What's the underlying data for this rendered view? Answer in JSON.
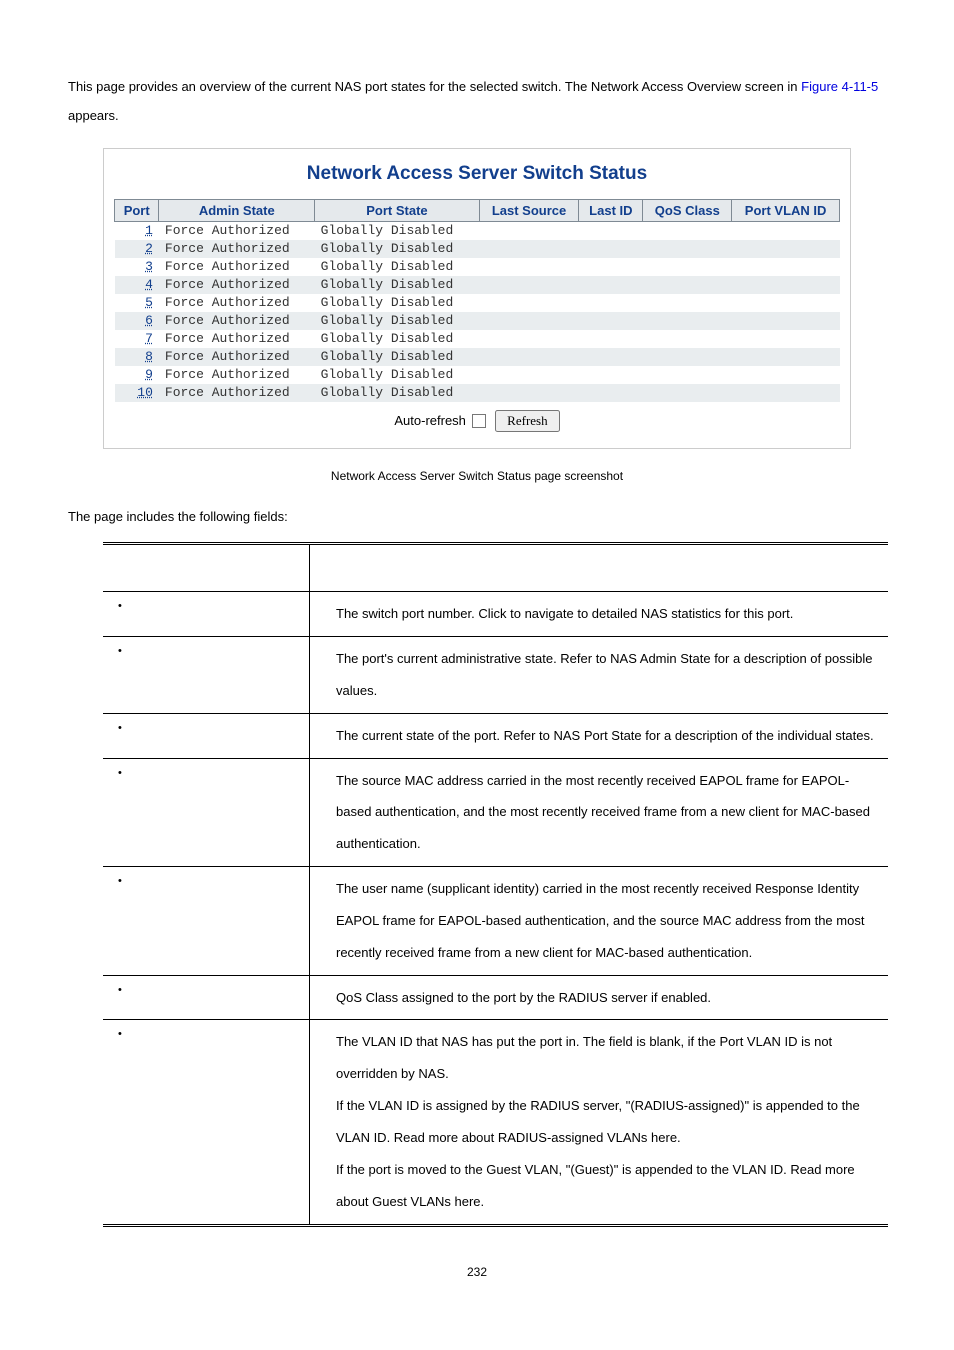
{
  "intro_text_1": "This page provides an overview of the current NAS port states for the selected switch. The Network Access Overview screen in ",
  "intro_link": "Figure 4-11-5",
  "intro_text_2": " appears.",
  "panel_title": "Network Access Server Switch Status",
  "status_headers": [
    "Port",
    "Admin State",
    "Port State",
    "Last Source",
    "Last ID",
    "QoS Class",
    "Port VLAN ID"
  ],
  "status_rows": [
    {
      "port": "1",
      "admin": "Force Authorized",
      "state": "Globally Disabled"
    },
    {
      "port": "2",
      "admin": "Force Authorized",
      "state": "Globally Disabled"
    },
    {
      "port": "3",
      "admin": "Force Authorized",
      "state": "Globally Disabled"
    },
    {
      "port": "4",
      "admin": "Force Authorized",
      "state": "Globally Disabled"
    },
    {
      "port": "5",
      "admin": "Force Authorized",
      "state": "Globally Disabled"
    },
    {
      "port": "6",
      "admin": "Force Authorized",
      "state": "Globally Disabled"
    },
    {
      "port": "7",
      "admin": "Force Authorized",
      "state": "Globally Disabled"
    },
    {
      "port": "8",
      "admin": "Force Authorized",
      "state": "Globally Disabled"
    },
    {
      "port": "9",
      "admin": "Force Authorized",
      "state": "Globally Disabled"
    },
    {
      "port": "10",
      "admin": "Force Authorized",
      "state": "Globally Disabled"
    }
  ],
  "auto_refresh_label": "Auto-refresh",
  "refresh_button": "Refresh",
  "caption": "Network Access Server Switch Status page screenshot",
  "fields_intro": "The page includes the following fields:",
  "desc_headers": [
    "",
    ""
  ],
  "desc_rows": [
    {
      "desc": "The switch port number. Click to navigate to detailed NAS statistics for this port."
    },
    {
      "desc": "The port's current administrative state. Refer to NAS Admin State for a description of possible values."
    },
    {
      "desc": "The current state of the port. Refer to NAS Port State for a description of the individual states."
    },
    {
      "desc": "The source MAC address carried in the most recently received EAPOL frame for EAPOL-based authentication, and the most recently received frame from a new client for MAC-based authentication."
    },
    {
      "desc": "The user name (supplicant identity) carried in the most recently received Response Identity EAPOL frame for EAPOL-based authentication, and the source MAC address from the most recently received frame from a new client for MAC-based authentication."
    },
    {
      "desc": "QoS Class assigned to the port by the RADIUS server if enabled."
    },
    {
      "desc": "The VLAN ID that NAS has put the port in. The field is blank, if the Port VLAN ID is not overridden by NAS.\nIf the VLAN ID is assigned by the RADIUS server, \"(RADIUS-assigned)\" is appended to the VLAN ID. Read more about RADIUS-assigned VLANs here.\nIf the port is moved to the Guest VLAN, \"(Guest)\" is appended to the VLAN ID. Read more about Guest VLANs here."
    }
  ],
  "page_number": "232"
}
